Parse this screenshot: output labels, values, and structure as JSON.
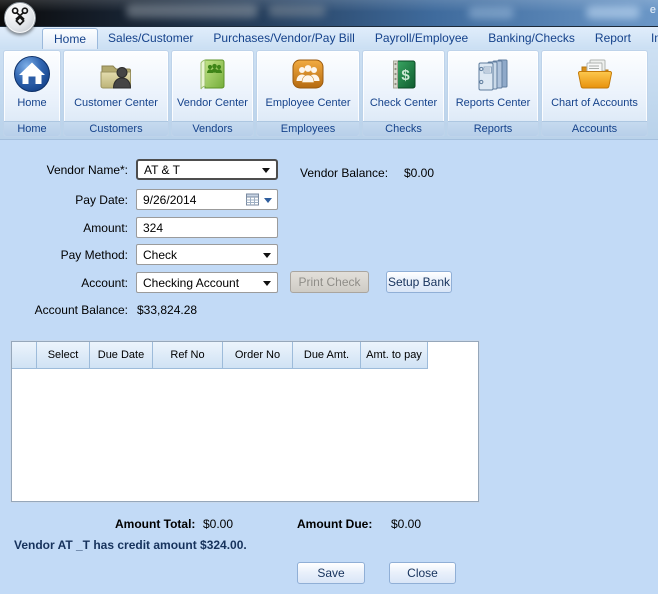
{
  "titlebar": {
    "fragment": "e"
  },
  "tabs": [
    {
      "label": "Home",
      "selected": true
    },
    {
      "label": "Sales/Customer",
      "selected": false
    },
    {
      "label": "Purchases/Vendor/Pay Bill",
      "selected": false
    },
    {
      "label": "Payroll/Employee",
      "selected": false
    },
    {
      "label": "Banking/Checks",
      "selected": false
    },
    {
      "label": "Report",
      "selected": false
    },
    {
      "label": "Import/Export",
      "selected": false
    }
  ],
  "ribbon": {
    "groups": [
      {
        "button": "Home",
        "caption": "Home",
        "icon": "home-icon"
      },
      {
        "button": "Customer Center",
        "caption": "Customers",
        "icon": "customer-center-icon"
      },
      {
        "button": "Vendor Center",
        "caption": "Vendors",
        "icon": "vendor-center-icon"
      },
      {
        "button": "Employee Center",
        "caption": "Employees",
        "icon": "employee-center-icon"
      },
      {
        "button": "Check Center",
        "caption": "Checks",
        "icon": "check-center-icon"
      },
      {
        "button": "Reports Center",
        "caption": "Reports",
        "icon": "reports-center-icon"
      },
      {
        "button": "Chart of Accounts",
        "caption": "Accounts",
        "icon": "chart-of-accounts-icon"
      }
    ]
  },
  "form": {
    "vendor_name": {
      "label": "Vendor Name*:",
      "value": "AT & T"
    },
    "vendor_balance": {
      "label": "Vendor Balance:",
      "value": "$0.00"
    },
    "pay_date": {
      "label": "Pay Date:",
      "value": "9/26/2014"
    },
    "amount": {
      "label": "Amount:",
      "value": "324"
    },
    "pay_method": {
      "label": "Pay Method:",
      "value": "Check"
    },
    "account": {
      "label": "Account:",
      "value": "Checking Account"
    },
    "print_check_label": "Print Check",
    "setup_bank_label": "Setup Bank",
    "account_balance": {
      "label": "Account Balance:",
      "value": "$33,824.28"
    }
  },
  "table": {
    "columns": [
      "Select",
      "Due Date",
      "Ref No",
      "Order No",
      "Due Amt.",
      "Amt. to pay"
    ],
    "rows": []
  },
  "totals": {
    "amount_total_label": "Amount Total:",
    "amount_total": "$0.00",
    "amount_due_label": "Amount Due:",
    "amount_due": "$0.00"
  },
  "credit_note": "Vendor AT _T has credit amount $324.00.",
  "actions": {
    "save": "Save",
    "close": "Close"
  }
}
